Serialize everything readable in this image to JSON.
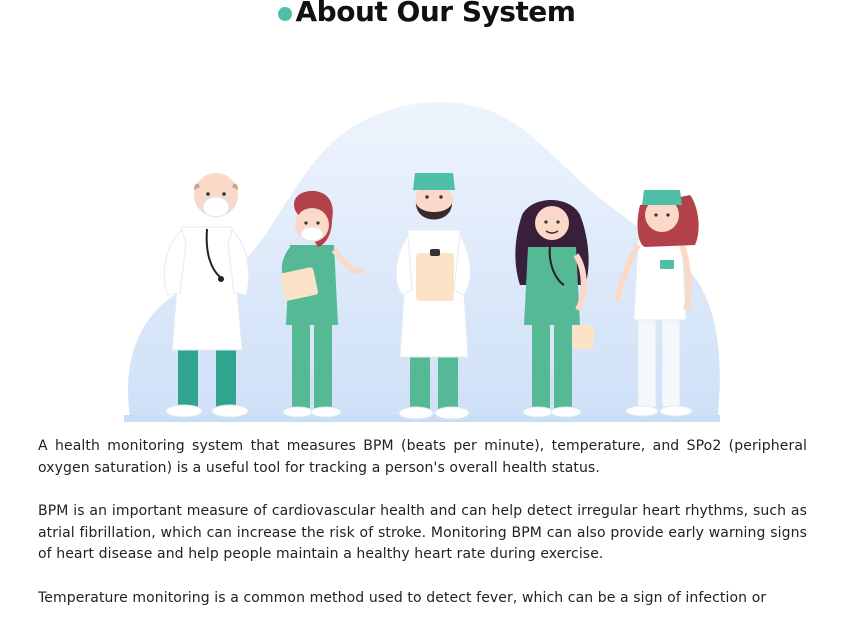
{
  "section": {
    "title": "About Our System",
    "accent_color": "#4fbfa8"
  },
  "illustration": {
    "description_icon": "medical-staff-illustration-icon"
  },
  "paragraphs": [
    "A health monitoring system that measures BPM (beats per minute), temperature, and SPo2 (peripheral oxygen saturation) is a useful tool for tracking a person's overall health status.",
    "BPM is an important measure of cardiovascular health and can help detect irregular heart rhythms, such as atrial fibrillation, which can increase the risk of stroke. Monitoring BPM can also provide early warning signs of heart disease and help people maintain a healthy heart rate during exercise.",
    "Temperature monitoring is a common method used to detect fever, which can be a sign of infection or"
  ]
}
